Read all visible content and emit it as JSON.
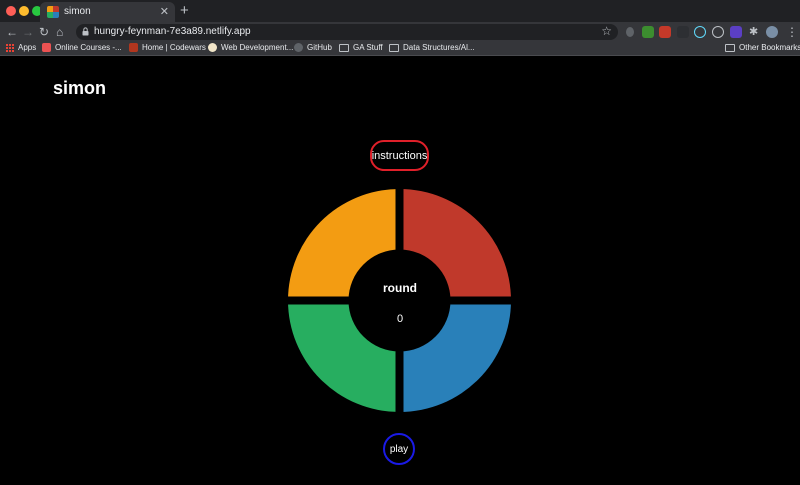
{
  "browser": {
    "tab_title": "simon",
    "url": "hungry-feynman-7e3a89.netlify.app",
    "bookmarks": [
      {
        "label": "Apps",
        "icon": "apps-grid-icon"
      },
      {
        "label": "Online Courses -...",
        "icon": "udemy-icon"
      },
      {
        "label": "Home | Codewars",
        "icon": "codewars-icon"
      },
      {
        "label": "Web Development...",
        "icon": "web-dev-icon"
      },
      {
        "label": "GitHub",
        "icon": "github-icon"
      },
      {
        "label": "GA Stuff",
        "icon": "folder-icon"
      },
      {
        "label": "Data Structures/Al...",
        "icon": "folder-icon"
      }
    ],
    "other_bookmarks": "Other Bookmarks"
  },
  "page": {
    "title": "simon",
    "instructions_label": "instructions",
    "round_label": "round",
    "round_value": "0",
    "play_label": "play"
  },
  "colors": {
    "orange": "#f39c12",
    "red": "#c0392b",
    "green": "#27ae60",
    "blue": "#2980b9",
    "instructions_border": "#e0202a",
    "play_border": "#1a1ae6"
  }
}
